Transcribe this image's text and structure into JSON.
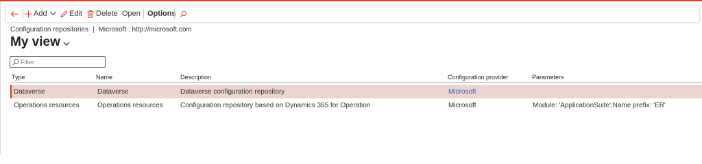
{
  "toolbar": {
    "add_label": "Add",
    "edit_label": "Edit",
    "delete_label": "Delete",
    "open_label": "Open",
    "options_label": "Options"
  },
  "breadcrumb": {
    "page": "Configuration repositories",
    "separator": "|",
    "context": "Microsoft : http://microsoft.com"
  },
  "view": {
    "title": "My view"
  },
  "filter": {
    "placeholder": "Filter",
    "value": ""
  },
  "grid": {
    "columns": [
      "Type",
      "Name",
      "Description",
      "Configuration provider",
      "Parameters"
    ],
    "rows": [
      {
        "type": "Dataverse",
        "name": "Dataverse",
        "description": "Dataverse configuration repository",
        "provider": "Microsoft",
        "parameters": "",
        "selected": true
      },
      {
        "type": "Operations resources",
        "name": "Operations resources",
        "description": "Configuration repository based on Dynamics 365 for Operation",
        "provider": "Microsoft",
        "parameters": "Module: 'ApplicationSuite';Name prefix: 'ER'",
        "selected": false
      }
    ]
  },
  "colors": {
    "accent": "#d9422c",
    "selected_row": "#ecd4d1",
    "link": "#2d63b7"
  },
  "icons": [
    "back-arrow-icon",
    "plus-icon",
    "chevron-down-icon",
    "pencil-icon",
    "trash-icon",
    "search-icon"
  ]
}
